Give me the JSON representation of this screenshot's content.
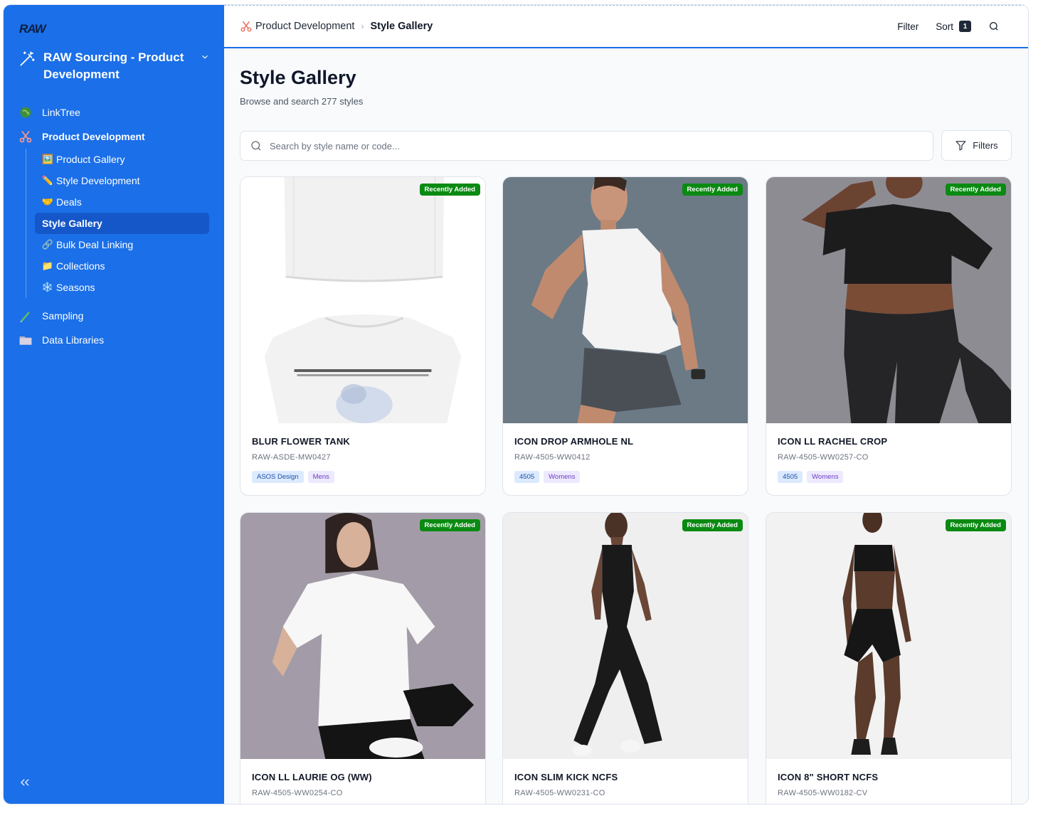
{
  "sidebar": {
    "logo": "RAW",
    "workspace": "RAW Sourcing - Product Development",
    "nav": [
      {
        "label": "LinkTree",
        "icon": "globe-icon"
      },
      {
        "label": "Product Development",
        "icon": "scissors-icon"
      }
    ],
    "sub": [
      {
        "label": "Product Gallery",
        "emoji": "🖼️"
      },
      {
        "label": "Style Development",
        "emoji": "✏️"
      },
      {
        "label": "Deals",
        "emoji": "🤝"
      },
      {
        "label": "Style Gallery",
        "emoji": ""
      },
      {
        "label": "Bulk Deal Linking",
        "emoji": "🔗"
      },
      {
        "label": "Collections",
        "emoji": "📁"
      },
      {
        "label": "Seasons",
        "emoji": "❄️"
      }
    ],
    "nav_bottom": [
      {
        "label": "Sampling",
        "icon": "pencil-icon"
      },
      {
        "label": "Data Libraries",
        "icon": "folder-icon"
      }
    ]
  },
  "header": {
    "breadcrumb_parent": "Product Development",
    "breadcrumb_current": "Style Gallery",
    "filter_label": "Filter",
    "sort_label": "Sort",
    "sort_count": "1"
  },
  "main": {
    "title": "Style Gallery",
    "subtitle": "Browse and search 277 styles",
    "search_placeholder": "Search by style name or code...",
    "filters_label": "Filters"
  },
  "cards": [
    {
      "name": "BLUR FLOWER TANK",
      "code": "RAW-ASDE-MW0427",
      "badge": "Recently Added",
      "tags": [
        "ASOS Design",
        "Mens"
      ]
    },
    {
      "name": "ICON DROP ARMHOLE NL",
      "code": "RAW-4505-WW0412",
      "badge": "Recently Added",
      "tags": [
        "4505",
        "Womens"
      ]
    },
    {
      "name": "ICON LL RACHEL CROP",
      "code": "RAW-4505-WW0257-CO",
      "badge": "Recently Added",
      "tags": [
        "4505",
        "Womens"
      ]
    },
    {
      "name": "ICON LL LAURIE OG (WW)",
      "code": "RAW-4505-WW0254-CO",
      "badge": "Recently Added",
      "tags": []
    },
    {
      "name": "ICON SLIM KICK NCFS",
      "code": "RAW-4505-WW0231-CO",
      "badge": "Recently Added",
      "tags": []
    },
    {
      "name": "ICON 8\" SHORT NCFS",
      "code": "RAW-4505-WW0182-CV",
      "badge": "Recently Added",
      "tags": []
    }
  ]
}
